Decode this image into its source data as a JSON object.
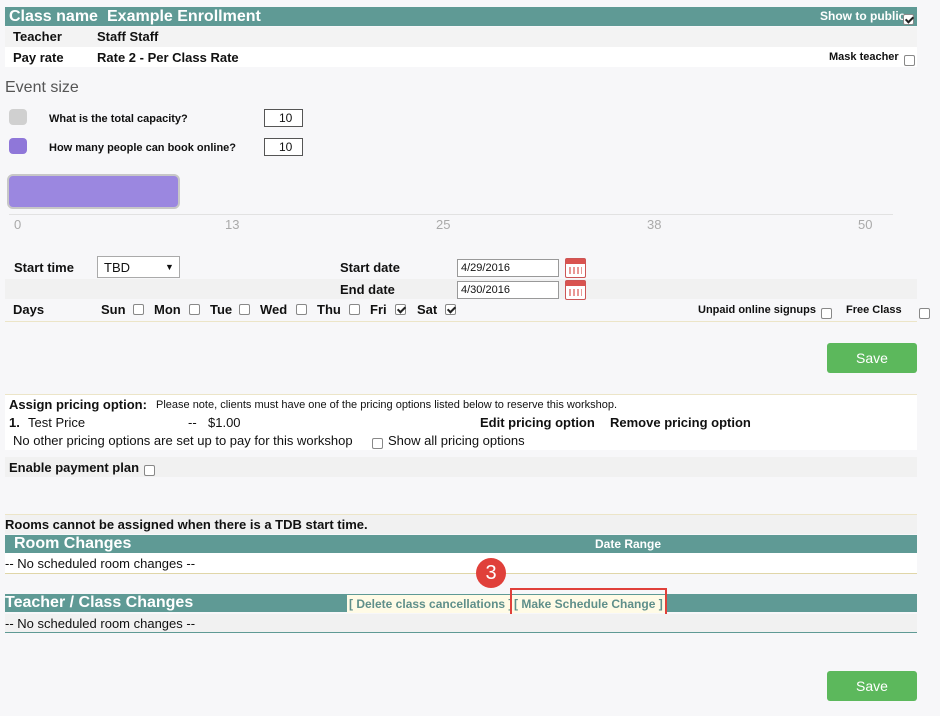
{
  "header": {
    "class_name_label": "Class name",
    "class_name_value": "Example Enrollment",
    "show_to_public_label": "Show to public",
    "show_to_public_checked": true
  },
  "teacher_row": {
    "label": "Teacher",
    "value": "Staff Staff"
  },
  "pay_rate_row": {
    "label": "Pay rate",
    "value": "Rate 2 - Per Class Rate",
    "mask_teacher_label": "Mask teacher"
  },
  "event_size": {
    "title": "Event size",
    "total_capacity_label": "What is the total capacity?",
    "total_capacity_value": "10",
    "online_label": "How many people can book online?",
    "online_value": "10",
    "slider_fraction": 0.2,
    "ticks": [
      "0",
      "13",
      "25",
      "38",
      "50"
    ]
  },
  "schedule": {
    "start_time_label": "Start time",
    "start_time_value": "TBD",
    "start_date_label": "Start date",
    "start_date_value": "4/29/2016",
    "end_date_label": "End date",
    "end_date_value": "4/30/2016",
    "days_label": "Days",
    "days": [
      {
        "label": "Sun",
        "checked": false
      },
      {
        "label": "Mon",
        "checked": false
      },
      {
        "label": "Tue",
        "checked": false
      },
      {
        "label": "Wed",
        "checked": false
      },
      {
        "label": "Thu",
        "checked": false
      },
      {
        "label": "Fri",
        "checked": true
      },
      {
        "label": "Sat",
        "checked": true
      }
    ],
    "unpaid_label": "Unpaid online signups",
    "free_class_label": "Free Class"
  },
  "save_label": "Save",
  "pricing": {
    "assign_label": "Assign pricing option:",
    "note": "Please note, clients must have one of the pricing options listed below to reserve this workshop.",
    "item_number": "1.",
    "item_name": "Test Price",
    "item_dash": "--",
    "item_price": "$1.00",
    "edit_label": "Edit pricing option",
    "remove_label": "Remove pricing option",
    "no_other": "No other pricing options are set up to pay for this workshop",
    "show_all_label": "Show all pricing options"
  },
  "payment_plan_label": "Enable payment plan",
  "rooms_notice": "Rooms cannot be assigned when there is a TDB start time.",
  "room_changes": {
    "title": "Room Changes",
    "date_range_label": "Date Range",
    "empty": "-- No scheduled room changes --"
  },
  "teacher_changes": {
    "title": "Teacher / Class Changes",
    "delete_link": "[ Delete class cancellations ]",
    "schedule_link": "[ Make Schedule Change ]",
    "empty": "-- No scheduled room changes --"
  },
  "callout_number": "3",
  "colors": {
    "header_bar": "#5f9a95",
    "slider_fill": "#9b87e0",
    "save_button": "#5cb85c",
    "callout": "#e0403a"
  }
}
